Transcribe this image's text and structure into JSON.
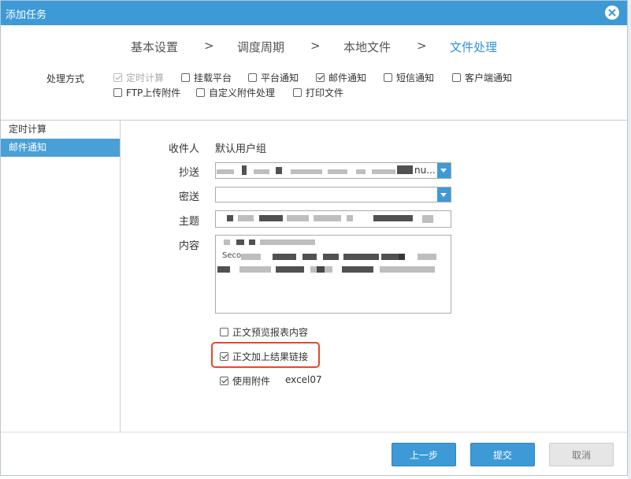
{
  "window": {
    "title": "添加任务"
  },
  "steps": [
    {
      "label": "基本设置"
    },
    {
      "label": "调度周期"
    },
    {
      "label": "本地文件"
    },
    {
      "label": "文件处理"
    }
  ],
  "step_separator": ">",
  "method": {
    "label": "处理方式",
    "options": [
      {
        "label": "定时计算",
        "checked": true,
        "disabled": true
      },
      {
        "label": "挂载平台",
        "checked": false
      },
      {
        "label": "平台通知",
        "checked": false
      },
      {
        "label": "邮件通知",
        "checked": true
      },
      {
        "label": "短信通知",
        "checked": false
      },
      {
        "label": "客户端通知",
        "checked": false
      },
      {
        "label": "FTP上传附件",
        "checked": false
      },
      {
        "label": "自定义附件处理",
        "checked": false
      },
      {
        "label": "打印文件",
        "checked": false
      }
    ]
  },
  "sidebar": {
    "items": [
      {
        "label": "定时计算",
        "active": false
      },
      {
        "label": "邮件通知",
        "active": true
      }
    ]
  },
  "form": {
    "recipient_label": "收件人",
    "recipient_value": "默认用户组",
    "cc_label": "抄送",
    "cc_value_suffix": "nu...",
    "bcc_label": "密送",
    "subject_label": "主题",
    "content_label": "内容",
    "content_visible_fragment": "Seco"
  },
  "options": {
    "preview_label": "正文预览报表内容",
    "preview_checked": false,
    "link_label": "正文加上结果链接",
    "link_checked": true,
    "attachment_label": "使用附件",
    "attachment_checked": true,
    "attachment_format": "excel07"
  },
  "buttons": {
    "prev": "上一步",
    "submit": "提交",
    "cancel": "取消"
  },
  "colors": {
    "accent": "#3d9ad6",
    "active_step": "#2f94d9",
    "highlight": "#e24a2c"
  }
}
